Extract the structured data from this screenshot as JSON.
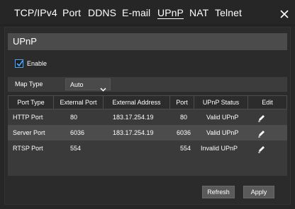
{
  "tabs": [
    {
      "label": "TCP/IPv4",
      "active": false
    },
    {
      "label": "Port",
      "active": false
    },
    {
      "label": "DDNS",
      "active": false
    },
    {
      "label": "E-mail",
      "active": false
    },
    {
      "label": "UPnP",
      "active": true
    },
    {
      "label": "NAT",
      "active": false
    },
    {
      "label": "Telnet",
      "active": false
    }
  ],
  "close_icon": "close-icon",
  "section": {
    "title": "UPnP"
  },
  "enable": {
    "label": "Enable",
    "checked": true
  },
  "map_type": {
    "label": "Map Type",
    "value": "Auto"
  },
  "table": {
    "columns": [
      "Port Type",
      "External Port",
      "External Address",
      "Port",
      "UPnP Status",
      "Edit"
    ],
    "rows": [
      {
        "port_type": "HTTP Port",
        "external_port": "80",
        "external_address": "183.17.254.19",
        "port": "80",
        "status": "Valid UPnP",
        "edit_icon": "edit-pencil-icon"
      },
      {
        "port_type": "Server Port",
        "external_port": "6036",
        "external_address": "183.17.254.19",
        "port": "6036",
        "status": "Valid UPnP",
        "edit_icon": "edit-pencil-icon"
      },
      {
        "port_type": "RTSP Port",
        "external_port": "554",
        "external_address": "",
        "port": "554",
        "status": "Invalid UPnP",
        "edit_icon": "edit-pencil-icon"
      }
    ]
  },
  "buttons": {
    "refresh": "Refresh",
    "apply": "Apply"
  },
  "colors": {
    "checkbox_accent": "#4aa8ff",
    "background": "#262626",
    "header_bar": "#4b4b4b",
    "row_highlight": "#4c4c4c"
  }
}
